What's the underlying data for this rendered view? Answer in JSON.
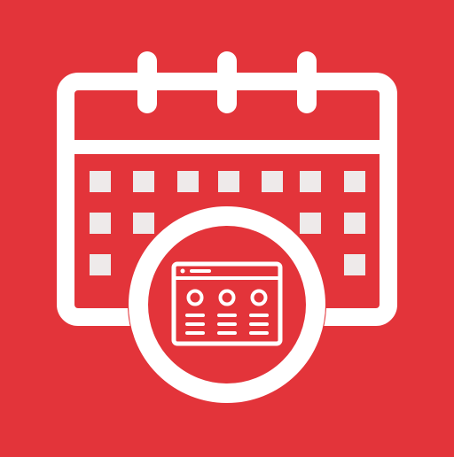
{
  "app_icon": {
    "icon_name": "calendar-schedule-app-icon",
    "background_color": "#e3343a",
    "foreground_color": "#ffffff",
    "cell_color": "#eeeaea",
    "calendar": {
      "ring_count": 3,
      "grid_cells": [
        [
          1,
          1,
          1,
          1,
          1,
          1,
          1
        ],
        [
          1,
          1,
          0,
          0,
          0,
          1,
          1
        ],
        [
          1,
          0,
          0,
          0,
          0,
          0,
          1
        ]
      ]
    },
    "magnifier_badge": {
      "icon_name": "browser-window-icon",
      "columns": 3
    }
  }
}
